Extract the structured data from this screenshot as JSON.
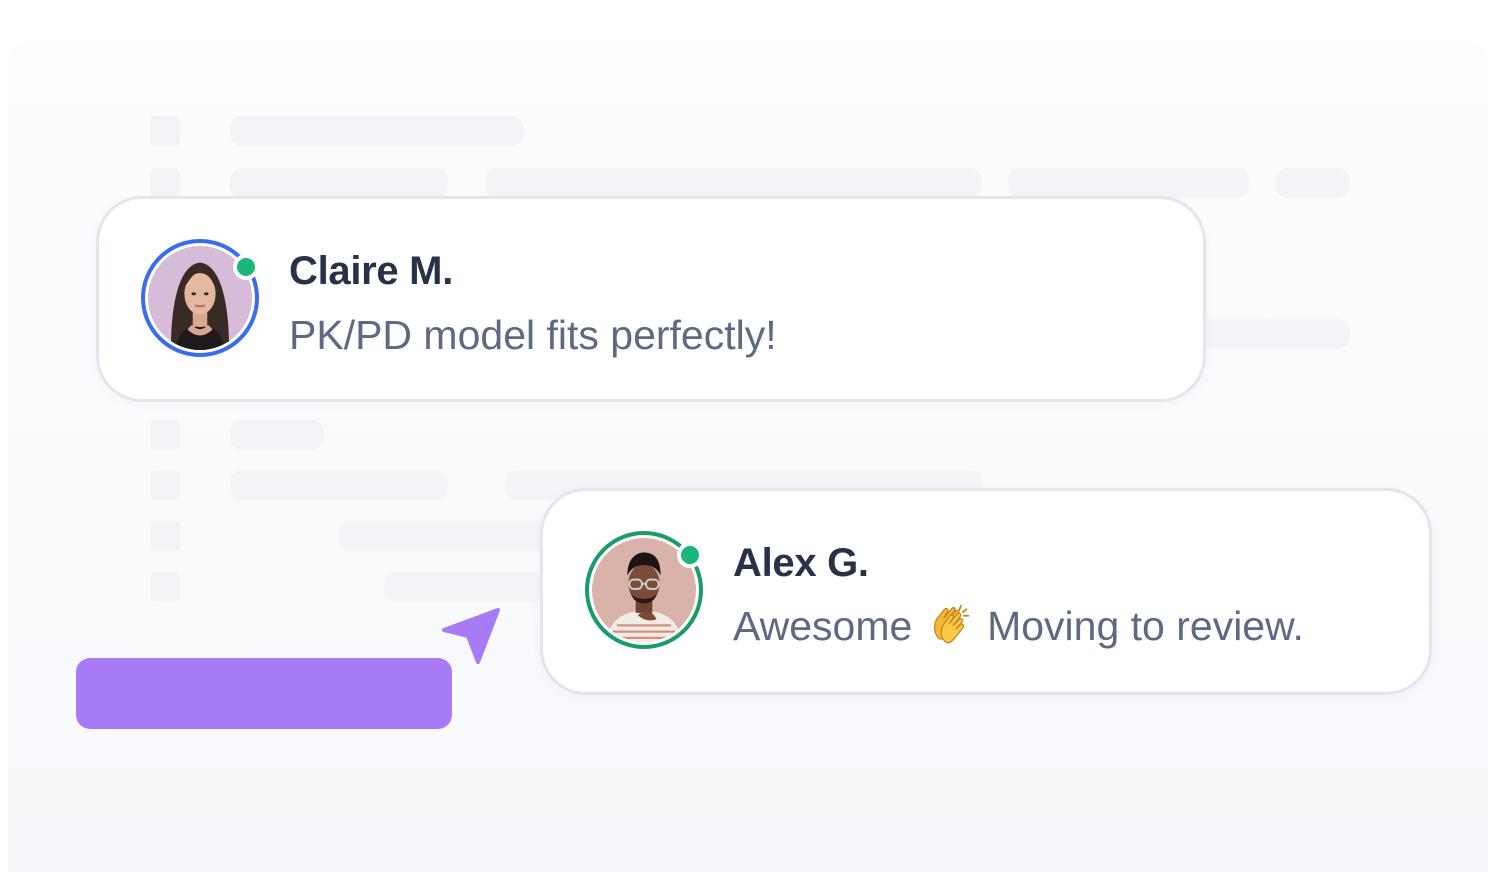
{
  "colors": {
    "accent_purple": "#a67bf5",
    "online_green": "#1ab67c",
    "claire_ring": "#3b6cf0",
    "alex_ring": "#1a9b6a"
  },
  "messages": [
    {
      "name": "Claire M.",
      "text": "PK/PD model fits perfectly!",
      "status": "online",
      "avatar_icon": "woman-portrait-avatar"
    },
    {
      "name": "Alex G.",
      "text_before": "Awesome",
      "emoji": "clapping-hands",
      "text_after": "Moving to review.",
      "status": "online",
      "avatar_icon": "man-portrait-avatar"
    }
  ],
  "cursor_icon": "pointer-arrow-icon"
}
